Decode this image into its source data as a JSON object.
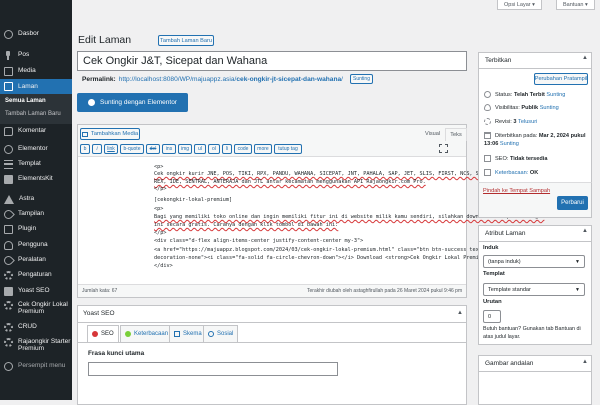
{
  "sidebar": {
    "dashboard": "Dasbor",
    "posts": "Pos",
    "media": "Media",
    "pages": "Laman",
    "pages_all": "Semua Laman",
    "pages_add": "Tambah Laman Baru",
    "comments": "Komentar",
    "elementor": "Elementor",
    "templates": "Templat",
    "elementskit": "ElementsKit",
    "astra": "Astra",
    "appearance": "Tampilan",
    "plugins": "Plugin",
    "users": "Pengguna",
    "tools": "Peralatan",
    "settings": "Pengaturan",
    "yoast": "Yoast SEO",
    "cek_ongkir": "Cek Ongkir Lokal Premium",
    "crud": "CRUD",
    "rajaongkir": "Rajaongkir Starter Premium",
    "collapse": "Persempit menu"
  },
  "top": {
    "screen_options": "Opsi Layar ▾",
    "help": "Bantuan ▾"
  },
  "editor": {
    "heading": "Edit Laman",
    "add_new": "Tambah Laman Baru",
    "title": "Cek Ongkir J&T, Sicepat dan Wahana",
    "permalink_label": "Permalink:",
    "permalink_base": "http://localhost:8080/WP/majuappz.asia/",
    "permalink_slug": "cek-ongkir-jt-sicepat-dan-wahana",
    "permalink_end": "/",
    "permalink_edit": "Sunting",
    "elementor_btn": "Sunting dengan Elementor",
    "add_media": "Tambahkan Media",
    "tab_visual": "Visual",
    "tab_text": "Teks",
    "quicktags": [
      "b",
      "i",
      "link",
      "b-quote",
      "del",
      "ins",
      "img",
      "ul",
      "ol",
      "li",
      "code",
      "more",
      "tutup tag"
    ],
    "code_lines": [
      "<p>",
      "Cek ongkir kurir JNE, POS, TIKI, RPX, PANDU, WAHANA, SICEPAT, JNT, PAHALA, SAP, JET, SLIS, FIRST, NCS, STAR, NINJA, LION, IDL,",
      "REX, IDE, SENTRAL, ANTERAJA dan JTL antar kecamatan menggunakan API Rajaongkir.com Pro.",
      "</p>",
      "[cekongkir-lokal-premium]",
      "<p>",
      "Bagi yang memiliki toko online dan ingin memiliki fitur ini di website milik kamu sendiri, silahkan download Wordpress Plugin",
      "ini secara gratis. Caranya dengan klik tombol di bawah ini:",
      "</p>",
      "<div class=\"d-flex align-items-center justify-content-center my-3\">",
      "<a href=\"https://majuappz.blogspot.com/2024/03/cek-ongkir-lokal-premium.html\" class=\"btn btn-success text-white mx-1 text-",
      "decoration-none\"><i class=\"fa-solid fa-circle-chevron-down\"></i> Download <strong>Cek Ongkir Lokal Premium</strong></a>",
      "</div>"
    ],
    "word_count": "Jumlah kata: 67",
    "last_edit": "Terakhir diubah oleh astaghfirullah pada 26 Maret 2024 pukul 9:46 pm"
  },
  "yoast": {
    "title": "Yoast SEO",
    "tabs": [
      "SEO",
      "Keterbacaan",
      "Skema",
      "Sosial"
    ],
    "focus_label": "Frasa kunci utama"
  },
  "publish": {
    "title": "Terbitkan",
    "preview": "Perubahan Pratampil",
    "status_label": "Status:",
    "status_value": "Telah Terbit",
    "status_edit": "Sunting",
    "visibility_label": "Visibilitas:",
    "visibility_value": "Publik",
    "visibility_edit": "Sunting",
    "revisions_label": "Revisi:",
    "revisions_value": "3",
    "revisions_link": "Telusuri",
    "published_label": "Diterbitkan pada:",
    "published_date": "Mar 2, 2024 pukul",
    "published_time": "13:06",
    "published_edit": "Sunting",
    "seo_label": "SEO:",
    "seo_value": "Tidak tersedia",
    "readability_label": "Keterbacaan:",
    "readability_value": "OK",
    "trash": "Pindah ke Tempat Sampah",
    "update": "Perbarui"
  },
  "attributes": {
    "title": "Atribut Laman",
    "parent_label": "Induk",
    "parent_value": "(tanpa induk)",
    "template_label": "Templat",
    "template_value": "Template standar",
    "order_label": "Urutan",
    "order_value": "0",
    "help": "Butuh bantuan? Gunakan tab Bantuan di atas judul layar."
  },
  "featured": {
    "title": "Gambar andalan"
  }
}
